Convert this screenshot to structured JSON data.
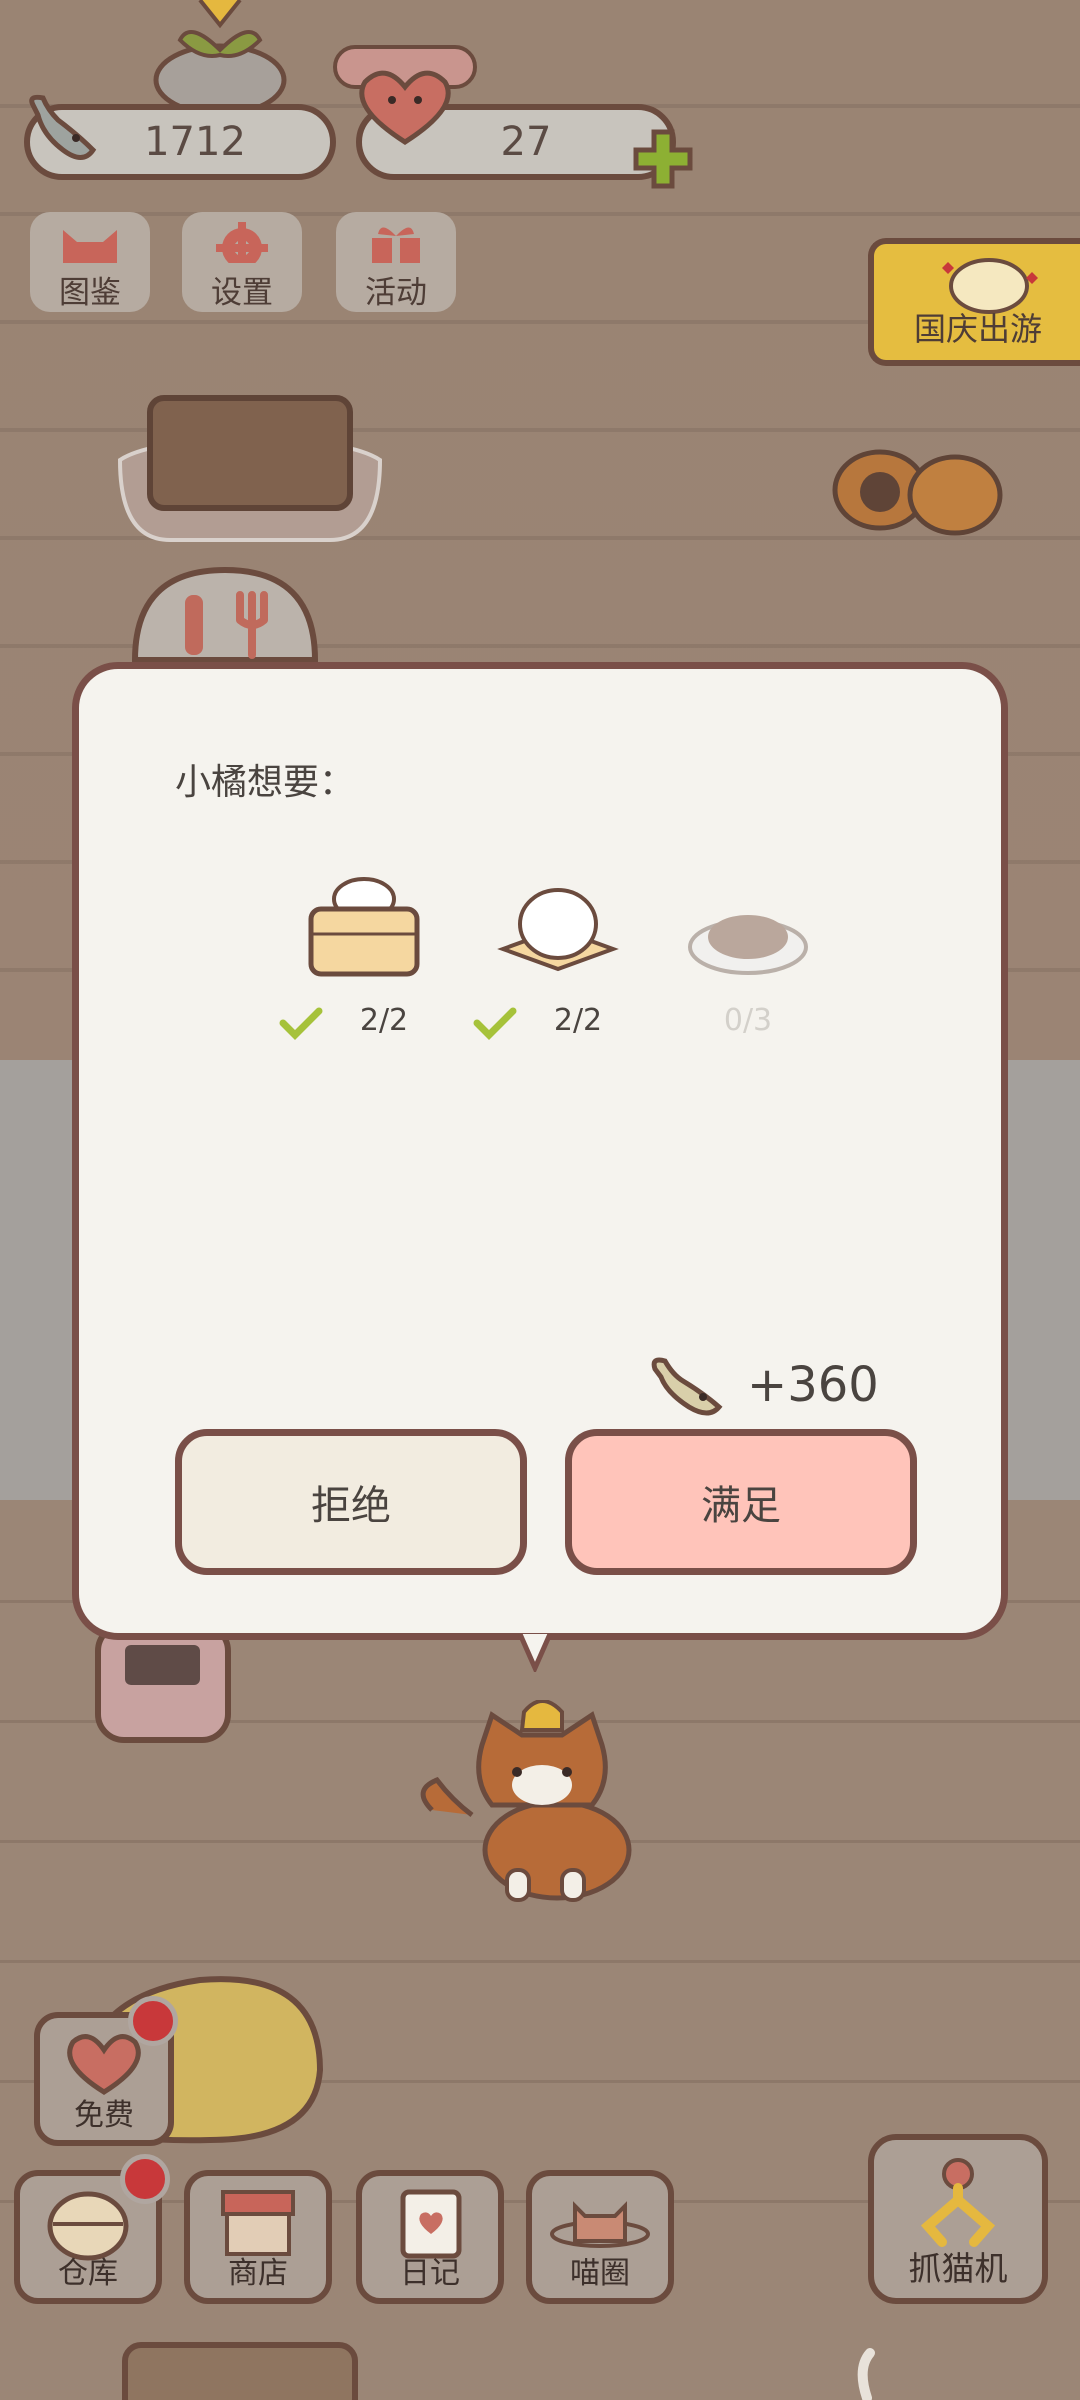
{
  "resources": {
    "fish_count": "1712",
    "heart_count": "27"
  },
  "top_menu": [
    {
      "label": "图鉴",
      "icon": "cat-face-icon"
    },
    {
      "label": "设置",
      "icon": "gear-icon"
    },
    {
      "label": "活动",
      "icon": "gift-icon"
    }
  ],
  "event_banner": {
    "label": "国庆出游"
  },
  "dialog": {
    "title": "小橘想要：",
    "foods": [
      {
        "icon": "steamed-bun-basket-icon",
        "progress": "2/2",
        "done": true
      },
      {
        "icon": "rice-cake-plate-icon",
        "progress": "2/2",
        "done": true
      },
      {
        "icon": "stew-dish-icon",
        "progress": "0/3",
        "done": false
      }
    ],
    "reward": "+360",
    "reject_label": "拒绝",
    "accept_label": "满足"
  },
  "bottom_bar": {
    "free": "免费",
    "warehouse": "仓库",
    "shop": "商店",
    "diary": "日记",
    "meow_circle": "喵圈",
    "claw_machine": "抓猫机"
  },
  "colors": {
    "accent_accept": "#ffc4ba",
    "reject_bg": "#f2ece0",
    "outline": "#7a4f48",
    "check_green": "#a6c23a",
    "badge_red": "#c8383a"
  }
}
